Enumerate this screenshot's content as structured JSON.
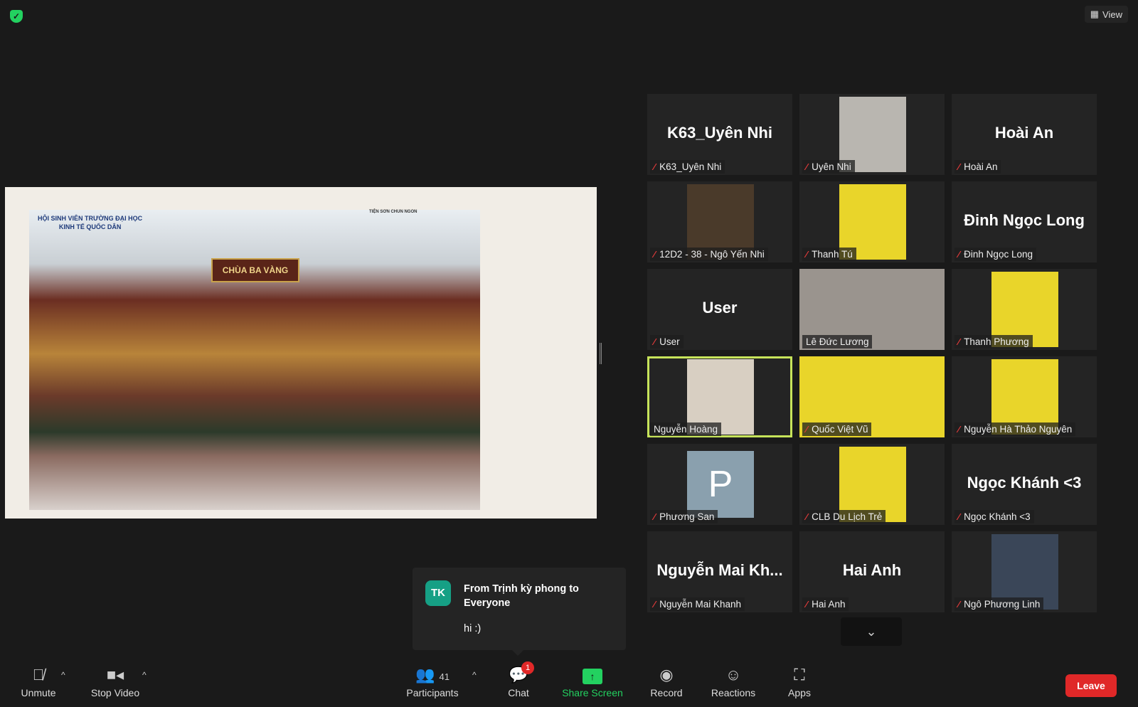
{
  "header": {
    "view_label": "View"
  },
  "shared_screen": {
    "title_line1": "HỘI SINH VIÊN TRƯỜNG ĐẠI HỌC",
    "title_line2": "KINH TẾ QUỐC DÂN",
    "corner_text": "TIỆN SƠN CHUN NGON",
    "sign": "CHÙA BA VÀNG"
  },
  "tiles": [
    {
      "name": "K63_Uyên Nhi",
      "big": "K63_Uyên Nhi",
      "muted": true
    },
    {
      "name": "Uyên Nhi",
      "video": "#b9b6b0",
      "muted": true
    },
    {
      "name": "Hoài An",
      "big": "Hoài An",
      "muted": true
    },
    {
      "name": "12D2 - 38 - Ngô Yến Nhi",
      "video": "#4a3a2a",
      "muted": true
    },
    {
      "name": "Thanh Tú",
      "video": "#e9d52a",
      "muted": true
    },
    {
      "name": "Đinh Ngọc Long",
      "big": "Đinh Ngọc Long",
      "muted": true
    },
    {
      "name": "User",
      "big": "User",
      "muted": true
    },
    {
      "name": "Lê Đức Lương",
      "video": "#9a948e",
      "muted": false,
      "full": true
    },
    {
      "name": "Thanh Phương",
      "video": "#e9d52a",
      "muted": true
    },
    {
      "name": "Nguyễn Hoàng",
      "video": "#d8cfc2",
      "muted": false,
      "active": true
    },
    {
      "name": "Quốc Việt Vũ",
      "video": "#e9d52a",
      "muted": true,
      "full": true
    },
    {
      "name": "Nguyễn Hà Thảo Nguyên",
      "video": "#e9d52a",
      "muted": true
    },
    {
      "name": "Phương San",
      "avatar": "P",
      "muted": true
    },
    {
      "name": "CLB Du Lịch Trẻ",
      "video": "#e9d52a",
      "muted": true
    },
    {
      "name": "Ngọc Khánh <3",
      "big": "Ngọc Khánh <3",
      "muted": true
    },
    {
      "name": "Nguyễn Mai Khanh",
      "big": "Nguyễn Mai Kh...",
      "muted": true
    },
    {
      "name": "Hai Anh",
      "big": "Hai Anh",
      "muted": true
    },
    {
      "name": "Ngô Phương Linh",
      "video": "#3a4658",
      "muted": true
    }
  ],
  "chat_popup": {
    "initials": "TK",
    "from": "From Trịnh kỳ phong to Everyone",
    "message": "hi :)"
  },
  "toolbar": {
    "unmute": "Unmute",
    "stop_video": "Stop Video",
    "participants": "Participants",
    "participant_count": "41",
    "chat": "Chat",
    "chat_badge": "1",
    "share_screen": "Share Screen",
    "record": "Record",
    "reactions": "Reactions",
    "apps": "Apps",
    "leave": "Leave"
  },
  "colors": {
    "accent_green": "#23d160",
    "leave_red": "#e02828",
    "active_speaker": "#c6e35a"
  }
}
